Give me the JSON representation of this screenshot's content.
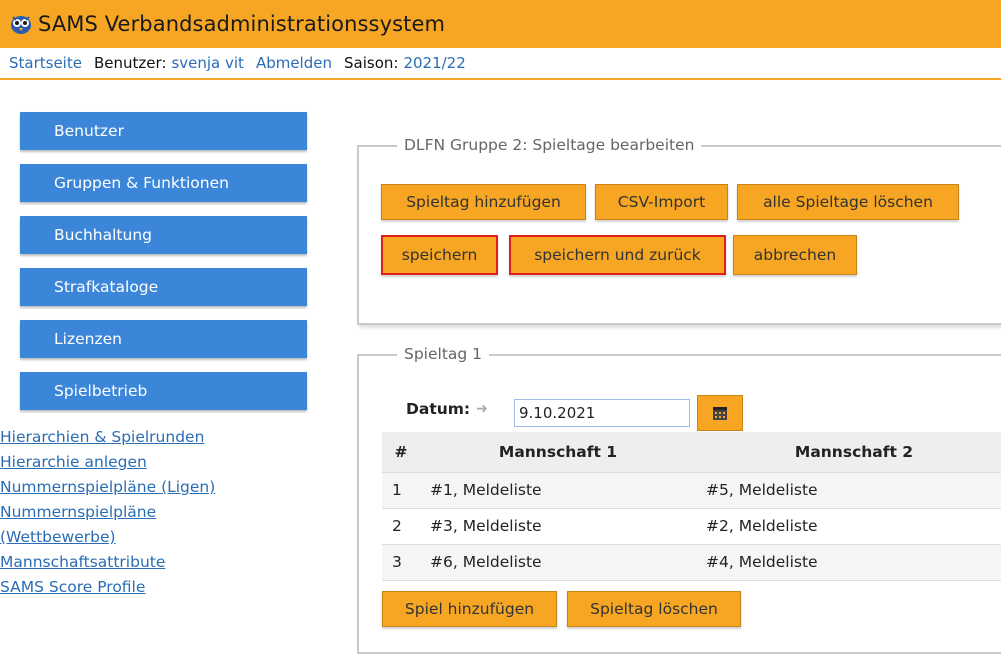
{
  "header": {
    "app_title": "SAMS Verbandsadministrationssystem",
    "logo_icon": "owl-icon",
    "brand_color": "#f6a623"
  },
  "nav": {
    "home": "Startseite",
    "user_label": "Benutzer:",
    "user_name": "svenja vit",
    "logout": "Abmelden",
    "season_label": "Saison:",
    "season_value": "2021/22"
  },
  "sidebar": {
    "items": [
      {
        "label": "Benutzer"
      },
      {
        "label": "Gruppen & Funktionen"
      },
      {
        "label": "Buchhaltung"
      },
      {
        "label": "Strafkataloge"
      },
      {
        "label": "Lizenzen"
      },
      {
        "label": "Spielbetrieb"
      }
    ],
    "sublinks": [
      {
        "label": "Hierarchien & Spielrunden"
      },
      {
        "label": "Hierarchie anlegen"
      },
      {
        "label": "Nummernspielpläne (Ligen)"
      },
      {
        "label": "Nummernspielpläne"
      },
      {
        "label": "(Wettbewerbe)"
      },
      {
        "label": "Mannschaftsattribute"
      },
      {
        "label": "SAMS Score Profile"
      }
    ]
  },
  "edit_panel": {
    "legend": "DLFN Gruppe 2: Spieltage bearbeiten",
    "add_matchday": "Spieltag hinzufügen",
    "csv_import": "CSV-Import",
    "delete_all": "alle Spieltage löschen",
    "save": "speichern",
    "save_back": "speichern und zurück",
    "cancel": "abbrechen"
  },
  "matchday": {
    "legend": "Spieltag 1",
    "date_label": "Datum:",
    "date_value": "9.10.2021",
    "calendar_icon": "calendar-icon",
    "columns": [
      "#",
      "Mannschaft 1",
      "Mannschaft 2"
    ],
    "rows": [
      [
        "1",
        "#1, Meldeliste",
        "#5, Meldeliste"
      ],
      [
        "2",
        "#3, Meldeliste",
        "#2, Meldeliste"
      ],
      [
        "3",
        "#6, Meldeliste",
        "#4, Meldeliste"
      ]
    ],
    "add_game": "Spiel hinzufügen",
    "delete_matchday": "Spieltag löschen"
  }
}
